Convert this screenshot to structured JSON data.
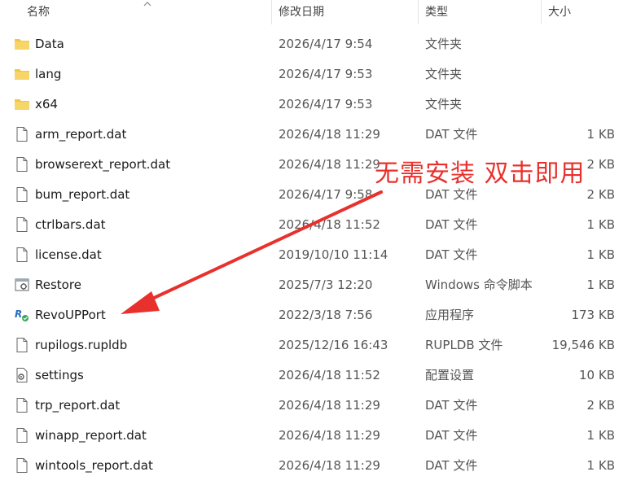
{
  "columns": {
    "name": "名称",
    "modified": "修改日期",
    "type": "类型",
    "size": "大小"
  },
  "files": [
    {
      "name": "Data",
      "modified": "2026/4/17 9:54",
      "type": "文件夹",
      "size": "",
      "icon": "folder-icon"
    },
    {
      "name": "lang",
      "modified": "2026/4/17 9:53",
      "type": "文件夹",
      "size": "",
      "icon": "folder-icon"
    },
    {
      "name": "x64",
      "modified": "2026/4/17 9:53",
      "type": "文件夹",
      "size": "",
      "icon": "folder-icon"
    },
    {
      "name": "arm_report.dat",
      "modified": "2026/4/18 11:29",
      "type": "DAT 文件",
      "size": "1 KB",
      "icon": "file-icon"
    },
    {
      "name": "browserext_report.dat",
      "modified": "2026/4/18 11:29",
      "type": "",
      "size": "2 KB",
      "icon": "file-icon"
    },
    {
      "name": "bum_report.dat",
      "modified": "2026/4/17 9:58",
      "type": "DAT 文件",
      "size": "2 KB",
      "icon": "file-icon"
    },
    {
      "name": "ctrlbars.dat",
      "modified": "2026/4/18 11:52",
      "type": "DAT 文件",
      "size": "1 KB",
      "icon": "file-icon"
    },
    {
      "name": "license.dat",
      "modified": "2019/10/10 11:14",
      "type": "DAT 文件",
      "size": "1 KB",
      "icon": "file-icon"
    },
    {
      "name": "Restore",
      "modified": "2025/7/3 12:20",
      "type": "Windows 命令脚本",
      "size": "1 KB",
      "icon": "script-icon"
    },
    {
      "name": "RevoUPPort",
      "modified": "2022/3/18 7:56",
      "type": "应用程序",
      "size": "173 KB",
      "icon": "app-icon"
    },
    {
      "name": "rupilogs.rupldb",
      "modified": "2025/12/16 16:43",
      "type": "RUPLDB 文件",
      "size": "19,546 KB",
      "icon": "file-icon"
    },
    {
      "name": "settings",
      "modified": "2026/4/18 11:52",
      "type": "配置设置",
      "size": "10 KB",
      "icon": "settings-file-icon"
    },
    {
      "name": "trp_report.dat",
      "modified": "2026/4/18 11:29",
      "type": "DAT 文件",
      "size": "2 KB",
      "icon": "file-icon"
    },
    {
      "name": "winapp_report.dat",
      "modified": "2026/4/18 11:29",
      "type": "DAT 文件",
      "size": "1 KB",
      "icon": "file-icon"
    },
    {
      "name": "wintools_report.dat",
      "modified": "2026/4/18 11:29",
      "type": "DAT 文件",
      "size": "1 KB",
      "icon": "file-icon"
    }
  ],
  "annotation": {
    "text": "无需安装 双击即用",
    "color": "#e8312d"
  },
  "colors": {
    "folder": "#f4c542",
    "accent_red": "#e8312d"
  }
}
